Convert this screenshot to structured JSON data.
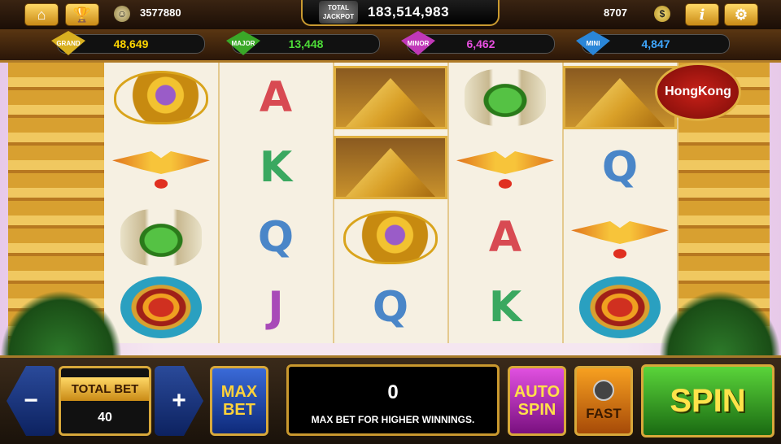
{
  "topbar": {
    "home_icon": "home-icon",
    "trophy_icon": "trophy-icon",
    "balance": "3577880",
    "jackpot_label": "TOTAL JACKPOT",
    "jackpot_value": "183,514,983",
    "coins": "8707",
    "coin_symbol": "$",
    "info_label": "i",
    "settings_icon": "gear-icon"
  },
  "jackpots": [
    {
      "name": "GRAND",
      "value": "48,649",
      "color": "#ffd600"
    },
    {
      "name": "MAJOR",
      "value": "13,448",
      "color": "#4ddc38"
    },
    {
      "name": "MINOR",
      "value": "6,462",
      "color": "#e84fe0"
    },
    {
      "name": "MINI",
      "value": "4,847",
      "color": "#3fa7ff"
    }
  ],
  "reels": [
    [
      "eye",
      "bird",
      "scarab",
      "shield"
    ],
    [
      "A",
      "K",
      "Q",
      "J"
    ],
    [
      "pyramid",
      "pyramid",
      "eye",
      "Q"
    ],
    [
      "scarab",
      "bird",
      "A",
      "K"
    ],
    [
      "pyramid",
      "Q",
      "bird",
      "shield"
    ]
  ],
  "badge": "HongKong",
  "controls": {
    "minus": "−",
    "plus": "+",
    "total_bet_label": "TOTAL BET",
    "total_bet_value": "40",
    "max_bet_line1": "MAX",
    "max_bet_line2": "BET",
    "win_value": "0",
    "message": "MAX BET FOR HIGHER WINNINGS.",
    "auto_line1": "AUTO",
    "auto_line2": "SPIN",
    "fast_label": "FAST",
    "spin_label": "SPIN"
  }
}
